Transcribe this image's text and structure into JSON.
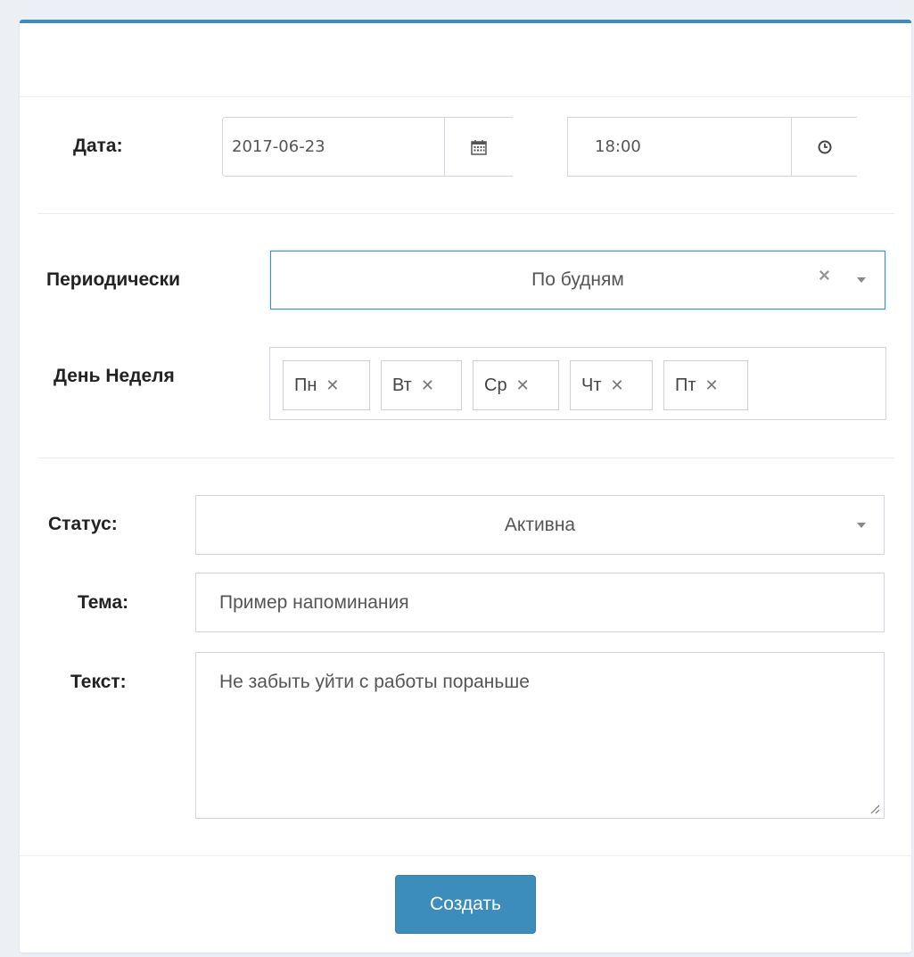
{
  "form": {
    "date_label": "Дата:",
    "date_value": "2017-06-23",
    "time_value": "18:00",
    "periodic_label": "Периодически",
    "periodic_value": "По будням",
    "weekday_label": "День Неделя",
    "weekdays": [
      "Пн",
      "Вт",
      "Ср",
      "Чт",
      "Пт"
    ],
    "status_label": "Статус:",
    "status_value": "Активна",
    "subject_label": "Тема:",
    "subject_value": "Пример напоминания",
    "text_label": "Текст:",
    "text_value": "Не забыть уйти с работы пораньше",
    "submit_label": "Создать"
  },
  "icons": {
    "calendar": "calendar-icon",
    "clock": "clock-icon",
    "clear": "close-icon",
    "caret": "caret-down-icon"
  },
  "colors": {
    "accent": "#3c8dbc",
    "border": "#d2d6de",
    "background": "#ecf0f5"
  }
}
